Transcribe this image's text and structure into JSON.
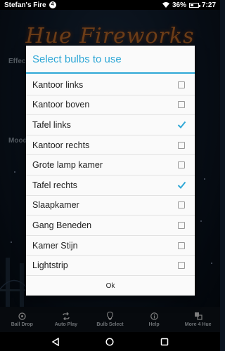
{
  "status_bar": {
    "device_name": "Stefan's Fire",
    "notification_count": "4",
    "battery_percent": "36%",
    "battery_level": 0.36,
    "time": "7:27",
    "icons": [
      "wifi-icon",
      "battery-icon"
    ]
  },
  "background_app": {
    "title": "Hue Fireworks",
    "labels": [
      "Effec",
      "Mood"
    ],
    "title_color": "#c8712c"
  },
  "dialog": {
    "title": "Select bulbs to use",
    "accent_color": "#2ea7d6",
    "bulbs": [
      {
        "label": "Kantoor links",
        "checked": false
      },
      {
        "label": "Kantoor boven",
        "checked": false
      },
      {
        "label": "Tafel links",
        "checked": true
      },
      {
        "label": "Kantoor rechts",
        "checked": false
      },
      {
        "label": "Grote lamp kamer",
        "checked": false
      },
      {
        "label": "Tafel rechts",
        "checked": true
      },
      {
        "label": "Slaapkamer",
        "checked": false
      },
      {
        "label": "Gang Beneden",
        "checked": false
      },
      {
        "label": "Kamer Stijn",
        "checked": false
      },
      {
        "label": "Lightstrip",
        "checked": false
      }
    ],
    "ok_label": "Ok"
  },
  "app_nav": {
    "items": [
      {
        "label": "Ball Drop",
        "icon": "ball-icon"
      },
      {
        "label": "Auto Play",
        "icon": "repeat-icon"
      },
      {
        "label": "Bulb Select",
        "icon": "bulb-icon"
      },
      {
        "label": "Help",
        "icon": "info-icon"
      },
      {
        "label": "More 4 Hue",
        "icon": "apps-icon"
      }
    ]
  },
  "system_nav": {
    "icons": [
      "back-icon",
      "home-icon",
      "recents-icon"
    ]
  }
}
